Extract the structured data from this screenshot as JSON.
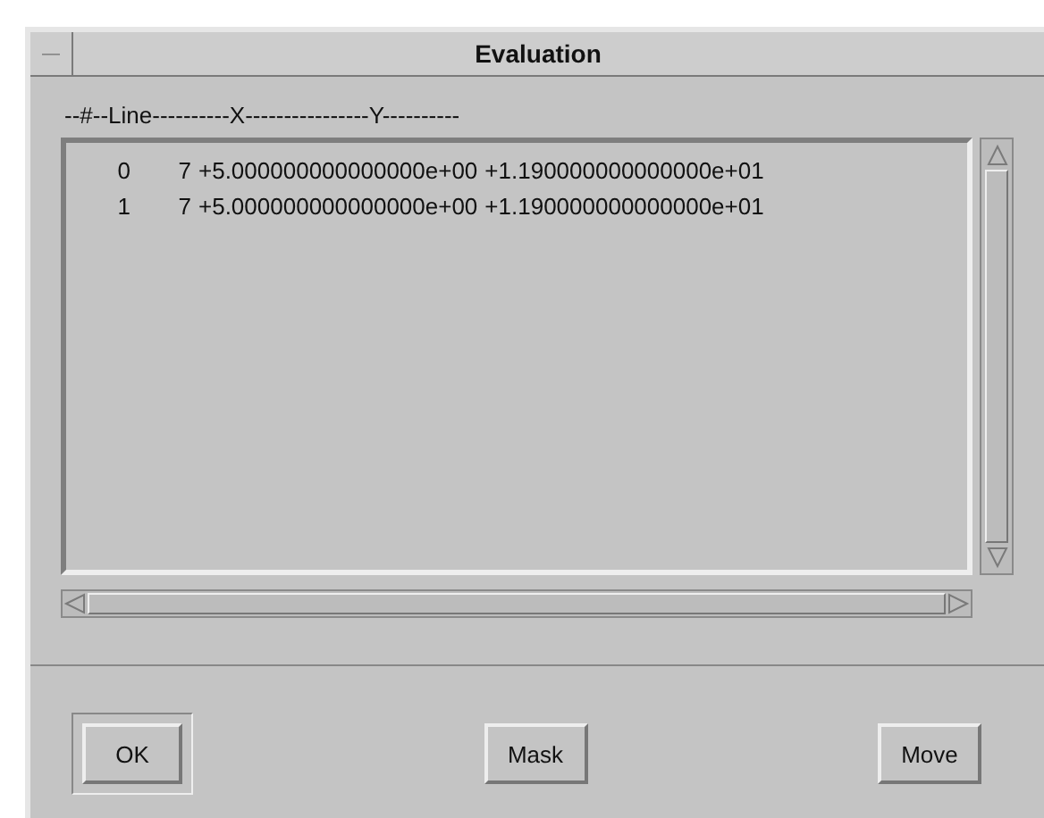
{
  "window": {
    "title": "Evaluation",
    "menu_glyph": "—"
  },
  "list": {
    "header": "--#--Line----------X----------------Y----------",
    "rows": [
      {
        "index": "0",
        "line": "7",
        "x": "+5.000000000000000e+00",
        "y": "+1.190000000000000e+01"
      },
      {
        "index": "1",
        "line": "7",
        "x": "+5.000000000000000e+00",
        "y": "+1.190000000000000e+01"
      }
    ]
  },
  "buttons": [
    {
      "label": "OK",
      "default": true
    },
    {
      "label": "Mask",
      "default": false
    },
    {
      "label": "Move",
      "default": false
    }
  ]
}
